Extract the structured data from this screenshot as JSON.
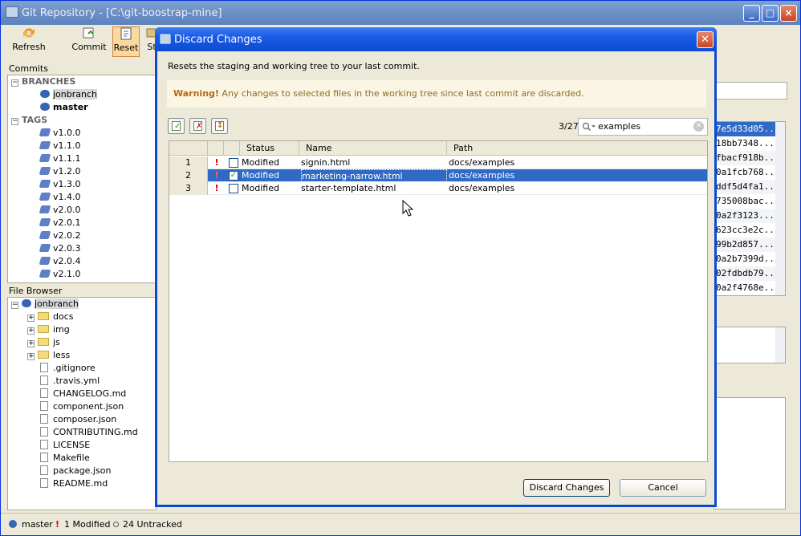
{
  "window": {
    "title": "Git Repository - [C:\\git-boostrap-mine]"
  },
  "toolbar": {
    "refresh": "Refresh",
    "commit": "Commit",
    "reset": "Reset",
    "stash": "St"
  },
  "commits": {
    "label": "Commits",
    "branches_label": "BRANCHES",
    "branches": [
      "jonbranch",
      "master"
    ],
    "tags_label": "TAGS",
    "tags": [
      "v1.0.0",
      "v1.1.0",
      "v1.1.1",
      "v1.2.0",
      "v1.3.0",
      "v1.4.0",
      "v2.0.0",
      "v2.0.1",
      "v2.0.2",
      "v2.0.3",
      "v2.0.4",
      "v2.1.0"
    ]
  },
  "file_browser": {
    "label": "File Browser",
    "root": "jonbranch",
    "folders": [
      "docs",
      "img",
      "js",
      "less"
    ],
    "files": [
      ".gitignore",
      ".travis.yml",
      "CHANGELOG.md",
      "component.json",
      "composer.json",
      "CONTRIBUTING.md",
      "LICENSE",
      "Makefile",
      "package.json",
      "README.md"
    ]
  },
  "hashes": [
    "7e5d33d05...",
    "18bb7348...",
    "fbacf918b...",
    "0a1fcb768...",
    "ddf5d4fa1...",
    "735008bac...",
    "0a2f3123...",
    "623cc3e2c...",
    "99b2d857...",
    "0a2b7399d...",
    "02fdbdb79...",
    "0a2f4768e..."
  ],
  "status": {
    "branch": "master",
    "modified": "1 Modified",
    "untracked": "24 Untracked"
  },
  "dialog": {
    "title": "Discard Changes",
    "description": "Resets the staging and working tree to your last commit.",
    "warning_bold": "Warning!",
    "warning_text": " Any changes to selected files in the working tree since last commit are discarded.",
    "count": "3/27",
    "search_value": "examples",
    "columns": [
      "Status",
      "Name",
      "Path"
    ],
    "rows": [
      {
        "num": "1",
        "status": "Modified",
        "name": "signin.html",
        "path": "docs/examples",
        "checked": false
      },
      {
        "num": "2",
        "status": "Modified",
        "name": "marketing-narrow.html",
        "path": "docs/examples",
        "checked": true
      },
      {
        "num": "3",
        "status": "Modified",
        "name": "starter-template.html",
        "path": "docs/examples",
        "checked": false
      }
    ],
    "discard_button": "Discard Changes",
    "cancel_button": "Cancel"
  },
  "colors": {
    "selection": "#316ac5",
    "dialog_border": "#0a4bd4",
    "warning_text": "#8f6c2a"
  }
}
